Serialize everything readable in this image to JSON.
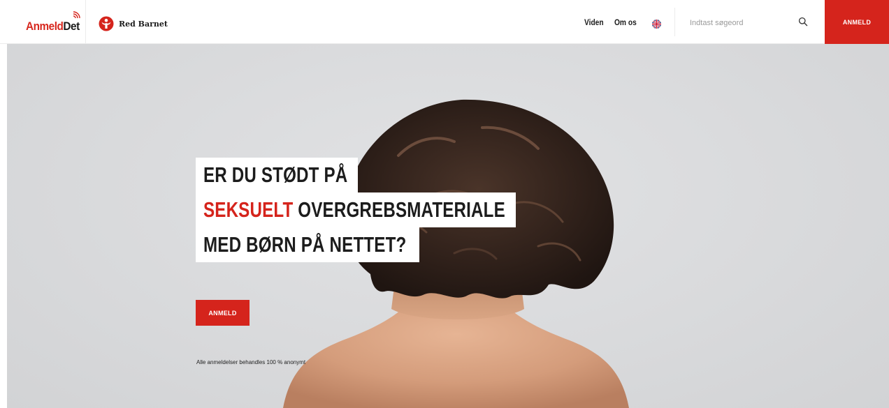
{
  "header": {
    "brand": {
      "part1": "Anmeld",
      "part2": "Det"
    },
    "partner": {
      "name": "Red Barnet"
    },
    "nav": [
      {
        "label": "Viden"
      },
      {
        "label": "Om os"
      }
    ],
    "language_icon": "uk-flag-icon",
    "search": {
      "placeholder": "Indtast søgeord",
      "icon": "search-icon"
    },
    "cta_label": "ANMELD"
  },
  "hero": {
    "headline": {
      "line1": "ER DU STØDT PÅ",
      "line2_highlight": "SEKSUELT",
      "line2_rest": " OVERGREBSMATERIALE",
      "line3": "MED BØRN PÅ NETTET?"
    },
    "cta_label": "ANMELD",
    "note": "Alle anmeldelser behandles 100 % anonymt"
  },
  "colors": {
    "accent": "#d5241c",
    "text": "#1c1c1c",
    "hero_background": "#dcdddf"
  }
}
